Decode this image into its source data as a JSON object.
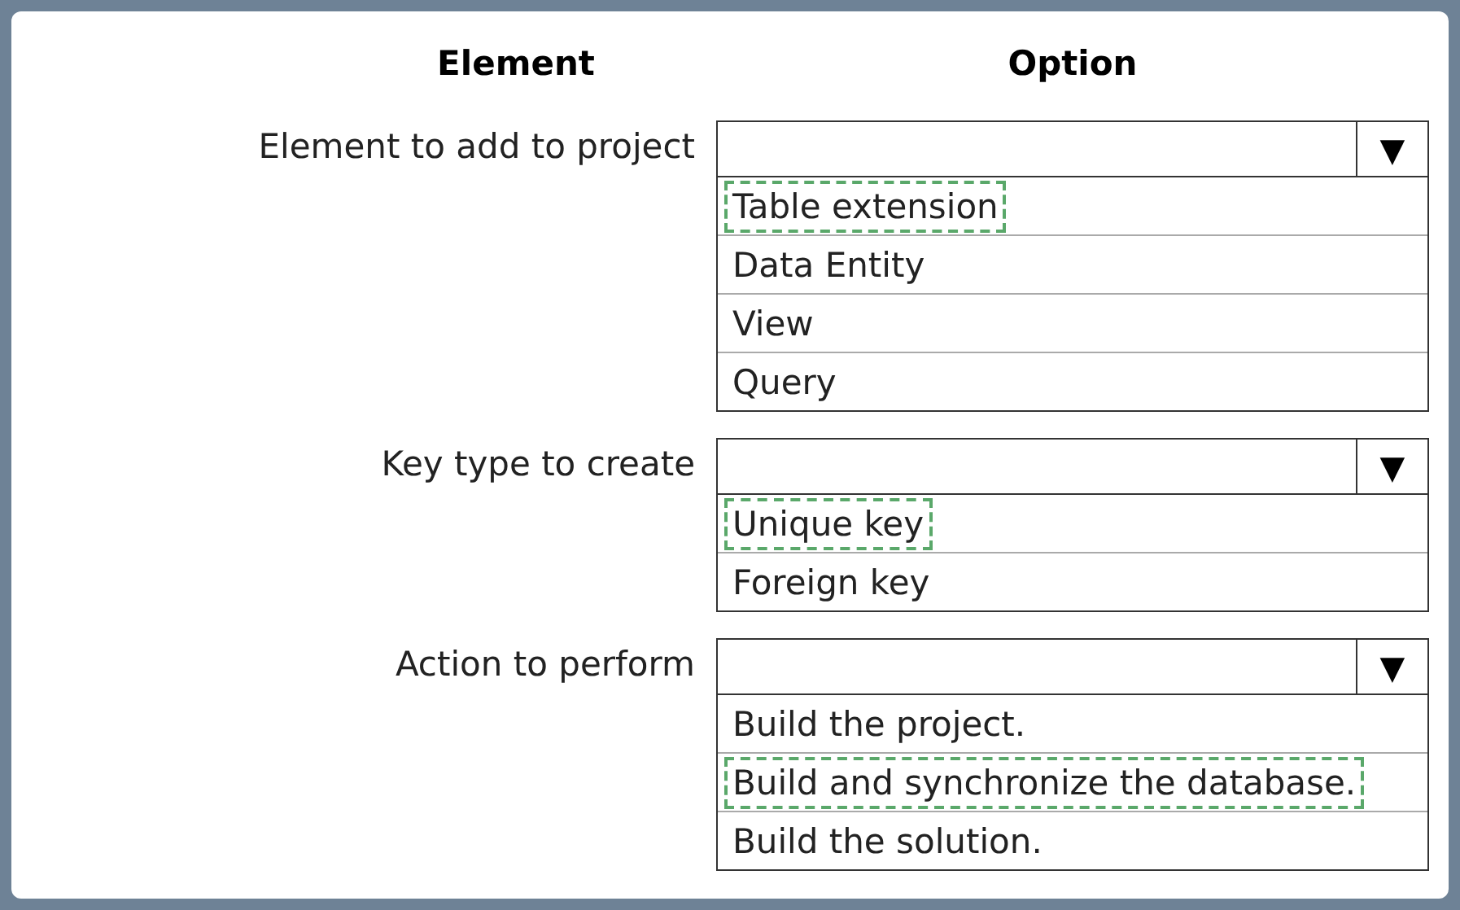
{
  "headers": {
    "element": "Element",
    "option": "Option"
  },
  "questions": [
    {
      "label": "Element to add to project",
      "arrow": "▼",
      "options": [
        {
          "text": "Table extension",
          "selected": true
        },
        {
          "text": "Data Entity",
          "selected": false
        },
        {
          "text": "View",
          "selected": false
        },
        {
          "text": "Query",
          "selected": false
        }
      ]
    },
    {
      "label": "Key type to create",
      "arrow": "▼",
      "options": [
        {
          "text": "Unique key",
          "selected": true
        },
        {
          "text": "Foreign key",
          "selected": false
        }
      ]
    },
    {
      "label": "Action to perform",
      "arrow": "▼",
      "options": [
        {
          "text": "Build the project.",
          "selected": false
        },
        {
          "text": "Build and synchronize the database.",
          "selected": true
        },
        {
          "text": "Build the solution.",
          "selected": false
        }
      ]
    }
  ]
}
